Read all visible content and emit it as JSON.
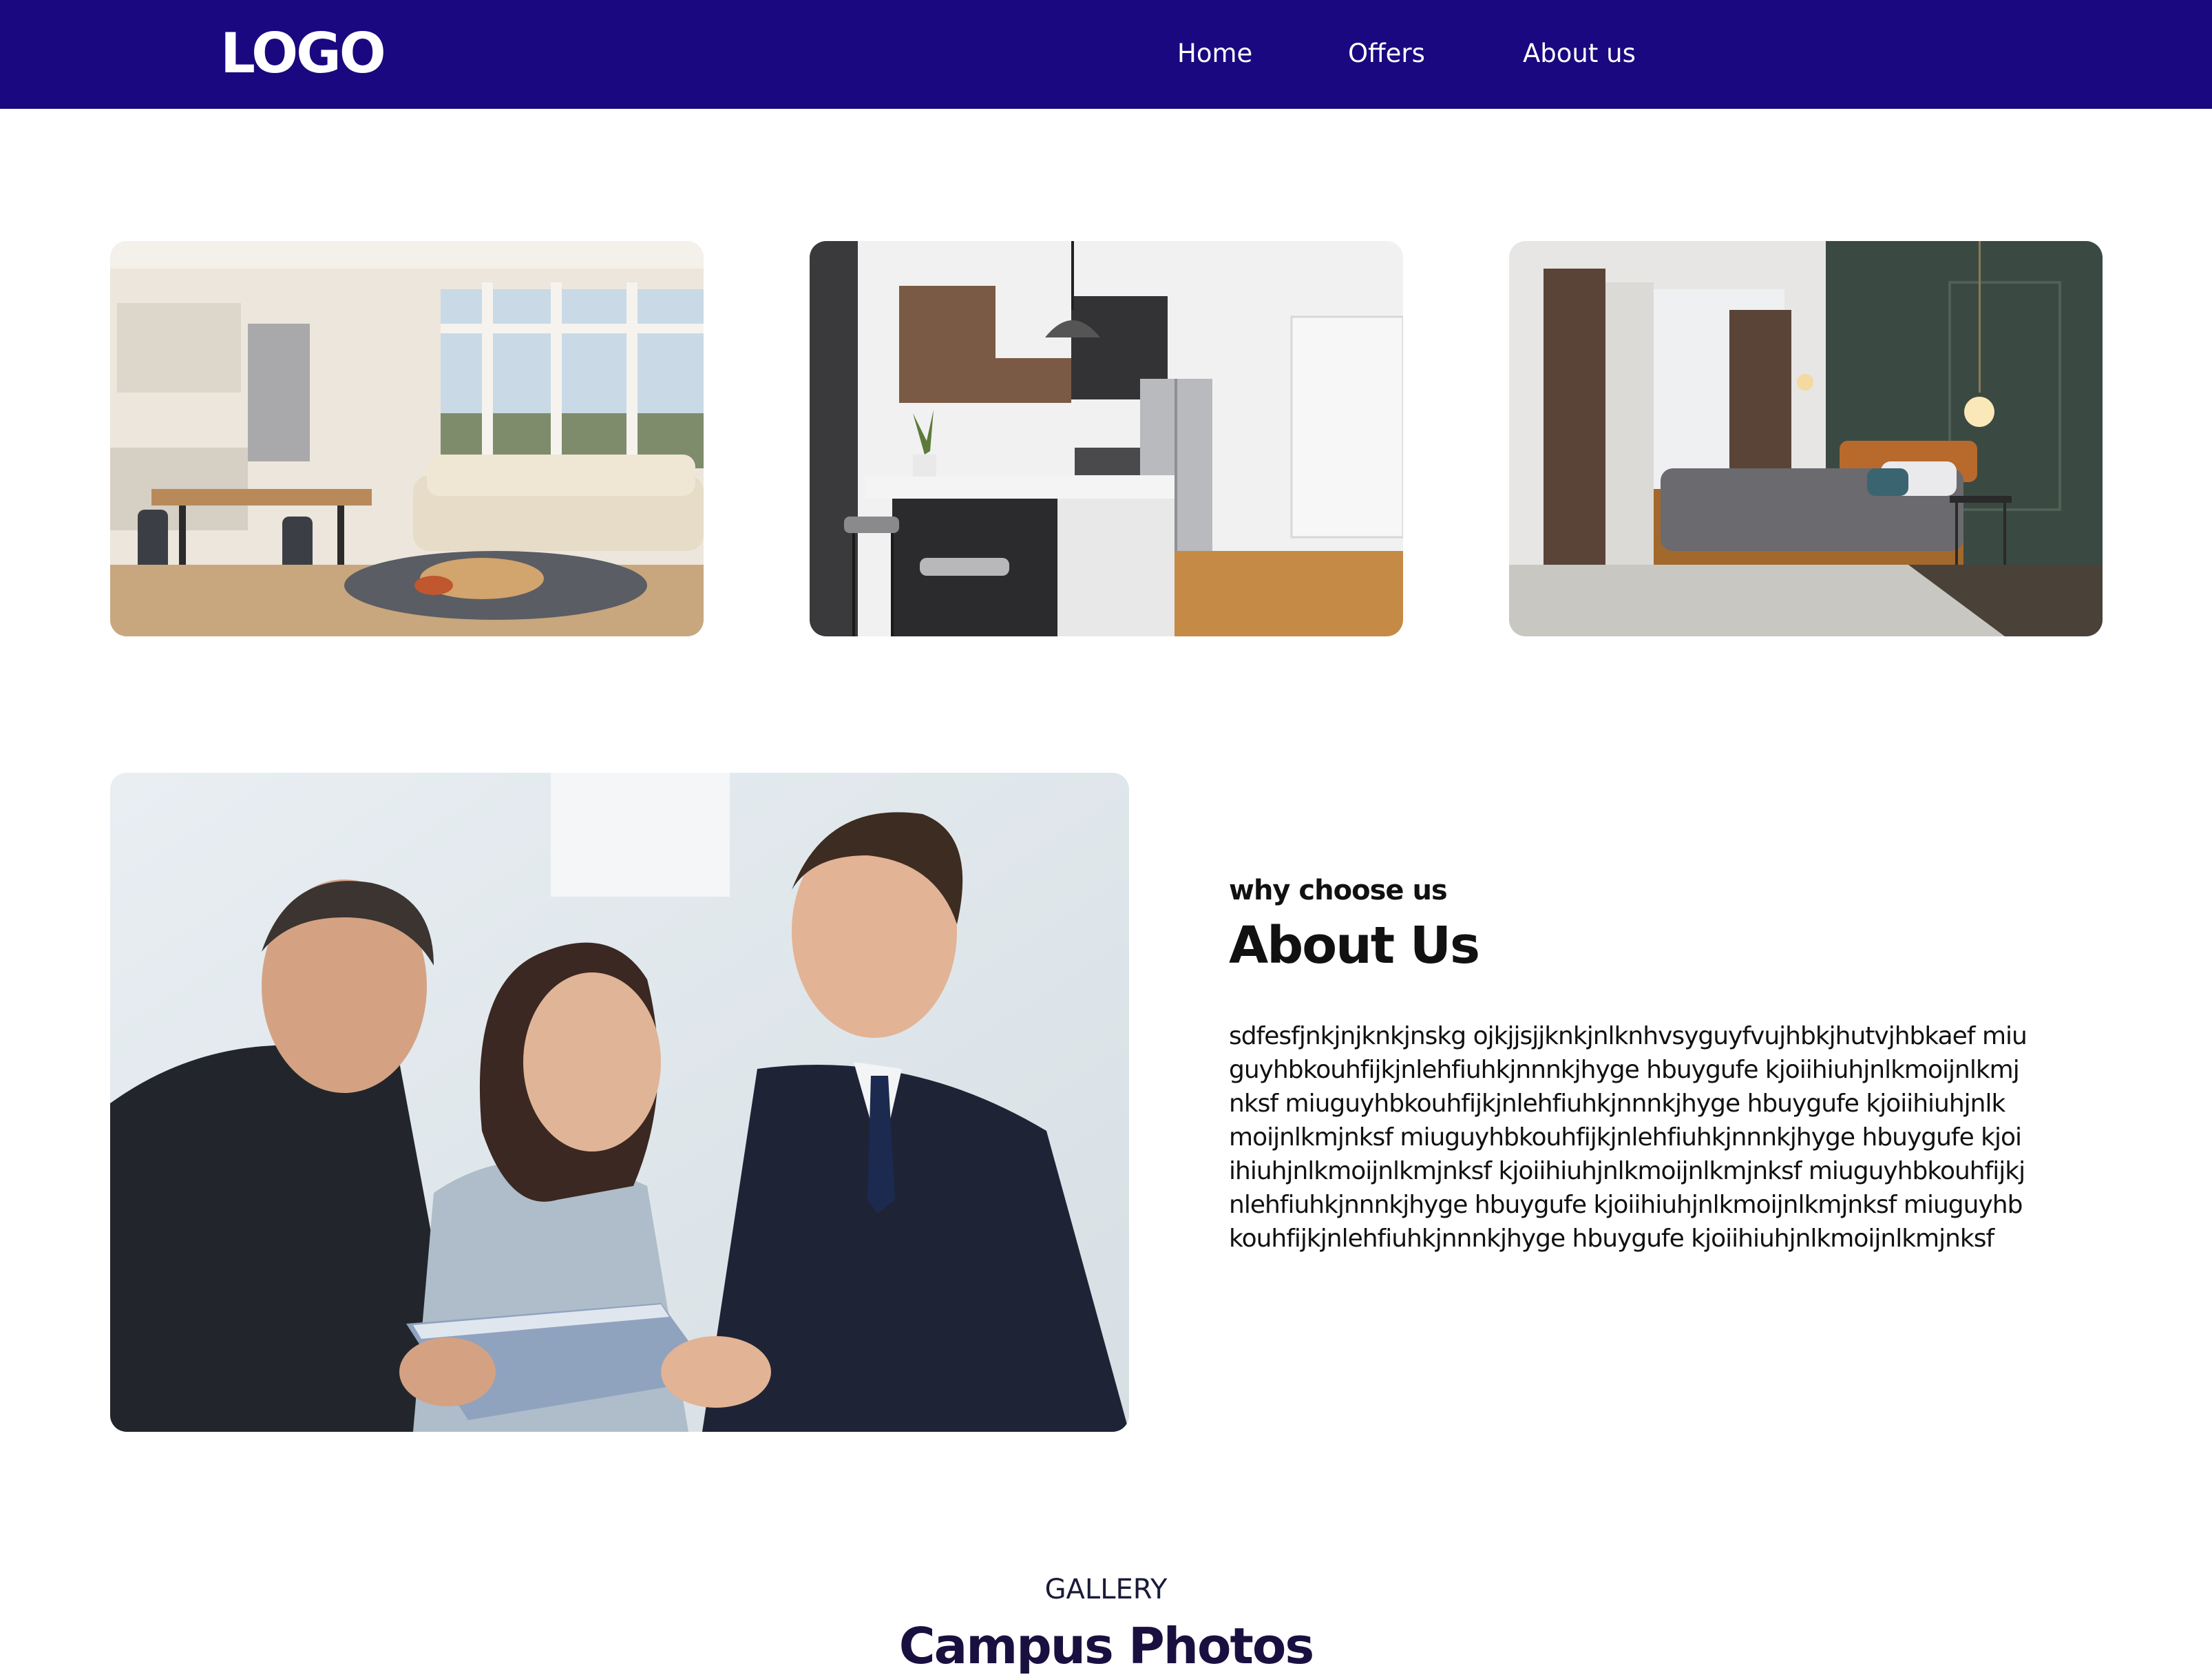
{
  "header": {
    "logo": "LOGO",
    "nav": [
      {
        "label": "Home"
      },
      {
        "label": "Offers"
      },
      {
        "label": "About us"
      }
    ],
    "background_color": "#1a0880"
  },
  "rooms": [
    {
      "name": "living-dining-room"
    },
    {
      "name": "kitchen"
    },
    {
      "name": "bedroom"
    }
  ],
  "about": {
    "eyebrow": "why choose us",
    "title": "About Us",
    "body": "sdfesfjnkjnjknkjnskg ojkjjsjjknkjnlknhvsyguyfvujhbkjhutvjhbkaef miuguyhbkouhfijkjnlehfiuhkjnnnkjhyge hbuygufe kjoiihiuhjnlkmoijnlkmjnksf miuguyhbkouhfijkjnlehfiuhkjnnnkjhyge hbuygufe kjoiihiuhjnlkmoijnlkmjnksf miuguyhbkouhfijkjnlehfiuhkjnnnkjhyge hbuygufe kjoiihiuhjnlkmoijnlkmjnksf kjoiihiuhjnlkmoijnlkmjnksf miuguyhbkouhfijkjnlehfiuhkjnnnkjhyge hbuygufe kjoiihiuhjnlkmoijnlkmjnksf miuguyhbkouhfijkjnlehfiuhkjnnnkjhyge hbuygufe kjoiihiuhjnlkmoijnlkmjnksf"
  },
  "gallery": {
    "eyebrow": "GALLERY",
    "title": "Campus Photos"
  }
}
